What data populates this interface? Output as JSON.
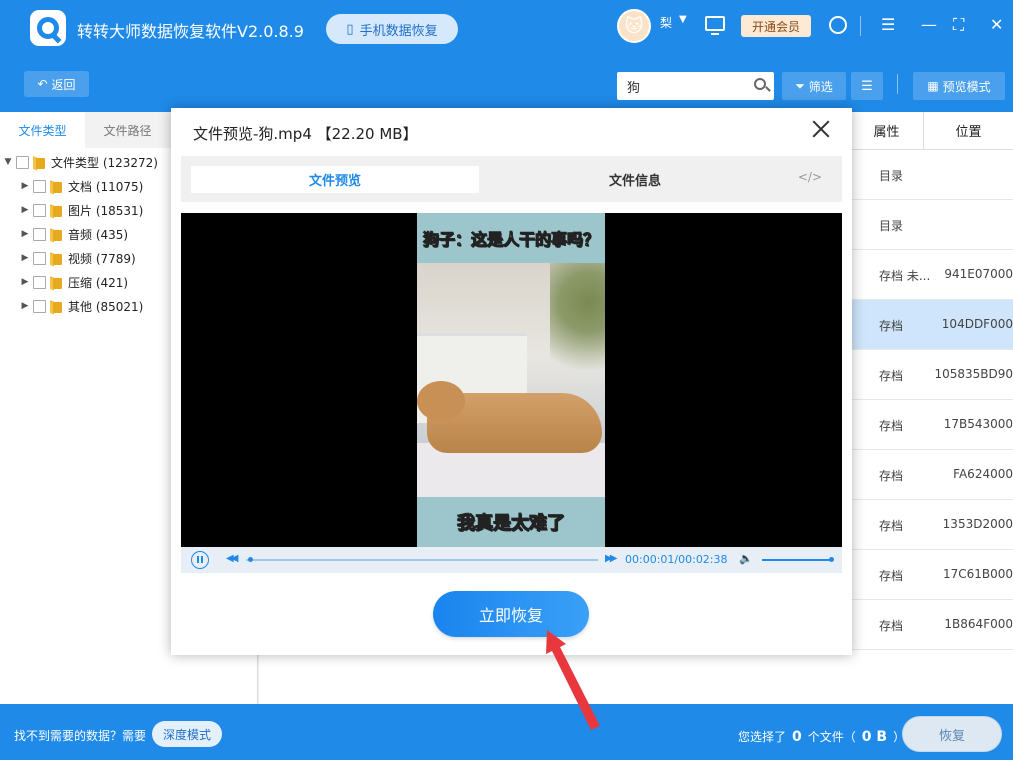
{
  "app": {
    "title": "转转大师数据恢复软件V2.0.8.9",
    "phone_recovery_label": "手机数据恢复",
    "username": "梨",
    "vip_label": "开通会员"
  },
  "toolbar": {
    "back_label": "返回",
    "search_value": "狗",
    "filter_label": "筛选",
    "preview_mode_label": "预览模式"
  },
  "left_panel": {
    "tabs": [
      {
        "label": "文件类型"
      },
      {
        "label": "文件路径"
      }
    ],
    "tree": [
      {
        "label": "文件类型 (123272)",
        "expanded": true
      },
      {
        "label": "文档 (11075)"
      },
      {
        "label": "图片 (18531)"
      },
      {
        "label": "音频 (435)"
      },
      {
        "label": "视频 (7789)"
      },
      {
        "label": "压缩 (421)"
      },
      {
        "label": "其他 (85021)"
      }
    ]
  },
  "table": {
    "headers": {
      "attr": "属性",
      "position": "位置"
    },
    "rows": [
      {
        "attr": "目录",
        "position": ""
      },
      {
        "attr": "目录",
        "position": ""
      },
      {
        "attr": "存档 未...",
        "position": "941E07000"
      },
      {
        "attr": "存档",
        "position": "104DDF000",
        "selected": true
      },
      {
        "attr": "存档",
        "position": "105835BD90"
      },
      {
        "attr": "存档",
        "position": "17B543000"
      },
      {
        "attr": "存档",
        "position": "FA624000"
      },
      {
        "attr": "存档",
        "position": "1353D2000"
      },
      {
        "attr": "存档",
        "position": "17C61B000"
      },
      {
        "attr": "存档",
        "position": "1B864F000"
      }
    ]
  },
  "modal": {
    "title": "文件预览-狗.mp4 【22.20 MB】",
    "tab_preview": "文件预览",
    "tab_info": "文件信息",
    "code_label": "</>",
    "video_caption_top": "狗子：这是人干的事吗？",
    "video_caption_bottom": "我真是太难了",
    "time_display": "00:00:01/00:02:38",
    "progress_fraction": 0.006,
    "restore_label": "立即恢复"
  },
  "bottom": {
    "not_found_text": "找不到需要的数据？需要",
    "deep_mode_label": "深度模式",
    "selected_prefix": "您选择了",
    "selected_count": "0",
    "selected_mid": "个文件（",
    "selected_size": "0 B",
    "selected_suffix": "）",
    "recover_label": "恢复"
  },
  "colors": {
    "brand": "#1f8ae8",
    "selected_row": "#cfe5fb",
    "annotation_arrow": "#e8383d"
  }
}
